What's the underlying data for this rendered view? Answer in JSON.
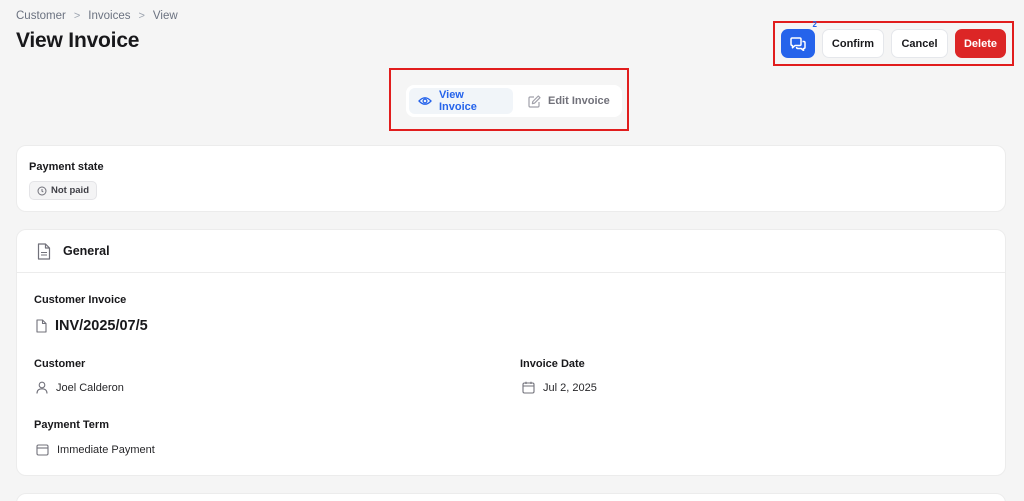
{
  "breadcrumb": {
    "items": [
      "Customer",
      "Invoices",
      "View"
    ],
    "separator": ">"
  },
  "page": {
    "title": "View Invoice"
  },
  "header_actions": {
    "chat_badge_count": "2",
    "confirm_label": "Confirm",
    "cancel_label": "Cancel",
    "delete_label": "Delete"
  },
  "tabs": {
    "view_label": "View Invoice",
    "edit_label": "Edit Invoice",
    "active": "view"
  },
  "payment": {
    "label": "Payment state",
    "status": "Not paid"
  },
  "general": {
    "title": "General",
    "customer_invoice_label": "Customer Invoice",
    "invoice_number": "INV/2025/07/5",
    "customer_label": "Customer",
    "customer_value": "Joel Calderon",
    "invoice_date_label": "Invoice Date",
    "invoice_date_value": "Jul 2, 2025",
    "payment_term_label": "Payment Term",
    "payment_term_value": "Immediate Payment"
  },
  "colors": {
    "primary": "#2563eb",
    "danger": "#dc2626",
    "highlight_frame": "#e11d1d",
    "background": "#f5f5f5"
  },
  "icons": {
    "chat": "chat-bubbles-icon",
    "view": "eye-icon",
    "edit": "pencil-square-icon",
    "status": "circle-clock-icon",
    "general": "document-icon",
    "invoice": "file-icon",
    "customer": "user-icon",
    "date": "calendar-icon",
    "term": "calendar-icon"
  }
}
